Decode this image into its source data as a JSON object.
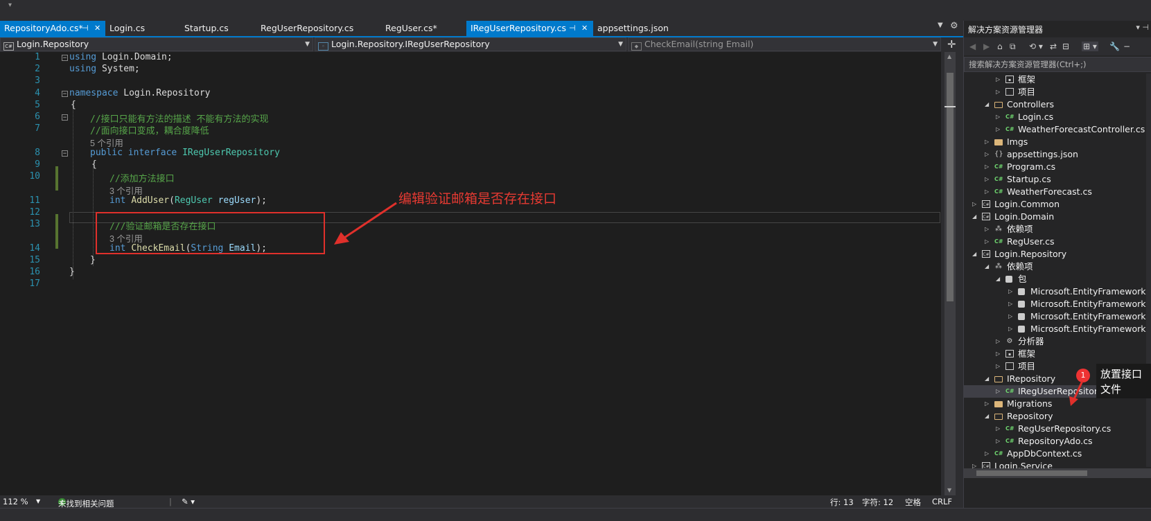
{
  "tabs": [
    {
      "label": "RepositoryAdo.cs*",
      "active": true,
      "pinned": true
    },
    {
      "label": "Login.cs"
    },
    {
      "label": "Startup.cs"
    },
    {
      "label": "RegUserRepository.cs"
    },
    {
      "label": "RegUser.cs*"
    },
    {
      "label": "IRegUserRepository.cs",
      "active": true,
      "pinned": true
    },
    {
      "label": "appsettings.json"
    }
  ],
  "navbar": {
    "project": "Login.Repository",
    "type": "Login.Repository.IRegUserRepository",
    "member": "CheckEmail(string Email)"
  },
  "editor": {
    "line_numbers": [
      "1",
      "2",
      "3",
      "4",
      "5",
      "6",
      "7",
      "8",
      "9",
      "10",
      "11",
      "12",
      "13",
      "14",
      "15",
      "16",
      "17"
    ],
    "lines": {
      "l1": {
        "kw": "using",
        "rest": " Login.Domain;"
      },
      "l2": {
        "kw": "using",
        "rest": " System;"
      },
      "l4": {
        "kw": "namespace",
        "rest": " Login.Repository"
      },
      "l5": "{",
      "l6": "//接口只能有方法的描述 不能有方法的实现",
      "l7": "//面向接口变成，耦合度降低",
      "ref1": "5 个引用",
      "l8": {
        "kw1": "public",
        "kw2": "interface",
        "type": "IRegUserRepository"
      },
      "l9": "{",
      "l10": "//添加方法接口",
      "ref2": "3 个引用",
      "l11": {
        "kw": "int",
        "method": "AddUser",
        "type": "RegUser",
        "param": "regUser",
        "tail": ");"
      },
      "l13": "///验证邮箱是否存在接口",
      "ref3": "3 个引用",
      "l14": {
        "kw": "int",
        "method": "CheckEmail",
        "type": "String",
        "param": "Email",
        "tail": ");"
      },
      "l15": "}",
      "l16": "}"
    }
  },
  "callout": "编辑验证邮箱是否存在接口",
  "status": {
    "zoom": "112 %",
    "issues": "未找到相关问题",
    "line": "行: 13",
    "col": "字符: 12",
    "whitespace": "空格",
    "eol": "CRLF"
  },
  "solution_explorer": {
    "title": "解决方案资源管理器",
    "search_placeholder": "搜索解决方案资源管理器(Ctrl+;)",
    "tree": [
      {
        "label": "框架",
        "icon": "framework-icon"
      },
      {
        "label": "项目",
        "icon": "project-ref-icon"
      },
      {
        "label": "Controllers",
        "icon": "folder-open-icon"
      },
      {
        "label": "Login.cs",
        "icon": "csharp-file-icon"
      },
      {
        "label": "WeatherForecastController.cs",
        "icon": "csharp-file-icon"
      },
      {
        "label": "Imgs",
        "icon": "folder-icon"
      },
      {
        "label": "appsettings.json",
        "icon": "json-file-icon"
      },
      {
        "label": "Program.cs",
        "icon": "csharp-file-icon"
      },
      {
        "label": "Startup.cs",
        "icon": "csharp-file-icon"
      },
      {
        "label": "WeatherForecast.cs",
        "icon": "csharp-file-icon"
      },
      {
        "label": "Login.Common",
        "icon": "csharp-project-icon"
      },
      {
        "label": "Login.Domain",
        "icon": "csharp-project-icon"
      },
      {
        "label": "依赖项",
        "icon": "dependencies-icon"
      },
      {
        "label": "RegUser.cs",
        "icon": "csharp-file-icon"
      },
      {
        "label": "Login.Repository",
        "icon": "csharp-project-icon"
      },
      {
        "label": "依赖项",
        "icon": "dependencies-icon"
      },
      {
        "label": "包",
        "icon": "package-icon"
      },
      {
        "label": "Microsoft.EntityFrameworkC",
        "icon": "package-icon"
      },
      {
        "label": "Microsoft.EntityFrameworkC",
        "icon": "package-icon"
      },
      {
        "label": "Microsoft.EntityFrameworkC",
        "icon": "package-icon"
      },
      {
        "label": "Microsoft.EntityFrameworkC",
        "icon": "package-icon"
      },
      {
        "label": "分析器",
        "icon": "analyzer-icon"
      },
      {
        "label": "框架",
        "icon": "framework-icon"
      },
      {
        "label": "项目",
        "icon": "project-ref-icon"
      },
      {
        "label": "IRepository",
        "icon": "folder-open-icon"
      },
      {
        "label": "IRegUserRepository.cs",
        "icon": "csharp-file-icon"
      },
      {
        "label": "Migrations",
        "icon": "folder-icon"
      },
      {
        "label": "Repository",
        "icon": "folder-open-icon"
      },
      {
        "label": "RegUserRepository.cs",
        "icon": "csharp-file-icon"
      },
      {
        "label": "RepositoryAdo.cs",
        "icon": "csharp-file-icon"
      },
      {
        "label": "AppDbContext.cs",
        "icon": "csharp-file-icon"
      },
      {
        "label": "Login.Service",
        "icon": "csharp-project-icon"
      }
    ]
  },
  "note": {
    "badge": "1",
    "text1": "放置接口",
    "text2": "文件"
  },
  "colors": {
    "accent": "#007acc",
    "callout": "#e0302b",
    "comment": "#57a64a",
    "keyword": "#569cd6",
    "type": "#4ec9b0"
  }
}
